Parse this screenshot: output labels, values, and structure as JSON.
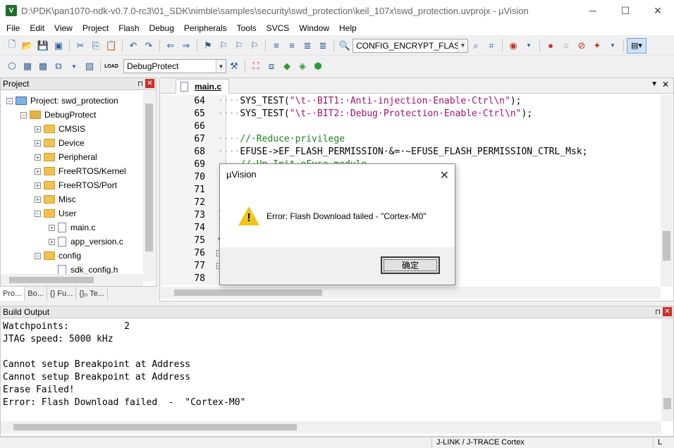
{
  "window": {
    "title": "D:\\PDK\\pan1070-ndk-v0.7.0-rc3\\01_SDK\\nimble\\samples\\security\\swd_protection\\keil_107x\\swd_protection.uvprojx - µVision",
    "icon_label": "V",
    "minimize": "─",
    "maximize": "☐",
    "close": "✕"
  },
  "menu": [
    "File",
    "Edit",
    "View",
    "Project",
    "Flash",
    "Debug",
    "Peripherals",
    "Tools",
    "SVCS",
    "Window",
    "Help"
  ],
  "toolbar": {
    "define_combo": "CONFIG_ENCRYPT_FLASH",
    "target_combo": "DebugProtect",
    "load_label": "LOAD"
  },
  "project_panel": {
    "title": "Project",
    "pin": "⊓",
    "close": "✕",
    "tree": [
      {
        "label": "Project: swd_protection",
        "kind": "project",
        "level": 0,
        "expander": "−"
      },
      {
        "label": "DebugProtect",
        "kind": "target",
        "level": 1,
        "expander": "−"
      },
      {
        "label": "CMSIS",
        "kind": "folder",
        "level": 2,
        "expander": "+"
      },
      {
        "label": "Device",
        "kind": "folder",
        "level": 2,
        "expander": "+"
      },
      {
        "label": "Peripheral",
        "kind": "folder",
        "level": 2,
        "expander": "+"
      },
      {
        "label": "FreeRTOS/Kernel",
        "kind": "folder",
        "level": 2,
        "expander": "+"
      },
      {
        "label": "FreeRTOS/Port",
        "kind": "folder",
        "level": 2,
        "expander": "+"
      },
      {
        "label": "Misc",
        "kind": "folder",
        "level": 2,
        "expander": "+"
      },
      {
        "label": "User",
        "kind": "folder",
        "level": 2,
        "expander": "−"
      },
      {
        "label": "main.c",
        "kind": "file",
        "level": 3,
        "expander": "+"
      },
      {
        "label": "app_version.c",
        "kind": "file",
        "level": 3,
        "expander": "+"
      },
      {
        "label": "config",
        "kind": "folder",
        "level": 2,
        "expander": "−"
      },
      {
        "label": "sdk_config.h",
        "kind": "file",
        "level": 3,
        "expander": ""
      }
    ],
    "tabs": [
      "Pro...",
      "Bo...",
      "{} Fu...",
      "{}₀ Te..."
    ]
  },
  "editor": {
    "tab": "main.c",
    "menu_arrow": "▼",
    "close": "✕",
    "lines": [
      {
        "n": "64",
        "parts": [
          [
            "d",
            "····"
          ],
          [
            "t",
            "SYS_TEST("
          ],
          [
            "s",
            "\"\\t-·BIT1:·Anti-injection·Enable·Ctrl\\n\""
          ],
          [
            "t",
            ");"
          ]
        ]
      },
      {
        "n": "65",
        "parts": [
          [
            "d",
            "····"
          ],
          [
            "t",
            "SYS_TEST("
          ],
          [
            "s",
            "\"\\t-·BIT2:·Debug·Protection·Enable·Ctrl\\n\""
          ],
          [
            "t",
            ");"
          ]
        ]
      },
      {
        "n": "66",
        "parts": []
      },
      {
        "n": "67",
        "parts": [
          [
            "d",
            "····"
          ],
          [
            "c",
            "//·Reduce·privilege"
          ]
        ]
      },
      {
        "n": "68",
        "parts": [
          [
            "d",
            "····"
          ],
          [
            "t",
            "EFUSE->EF_FLASH_PERMISSION·&=·~EFUSE_FLASH_PERMISSION_CTRL_Msk;"
          ]
        ]
      },
      {
        "n": "69",
        "parts": [
          [
            "d",
            "····"
          ],
          [
            "c",
            "//·Un-Init·eFuse·module"
          ]
        ]
      },
      {
        "n": "70",
        "parts": []
      },
      {
        "n": "71",
        "parts": []
      },
      {
        "n": "72",
        "parts": []
      },
      {
        "n": "73",
        "parts": [
          [
            "t",
            "}"
          ]
        ]
      },
      {
        "n": "74",
        "parts": []
      },
      {
        "n": "75",
        "parts": [
          [
            "t",
            "v"
          ]
        ]
      },
      {
        "n": "76",
        "parts": [
          [
            "t",
            "{"
          ]
        ],
        "fold": "−"
      },
      {
        "n": "77",
        "parts": [
          [
            "t",
            "#"
          ]
        ],
        "fold": "−"
      },
      {
        "n": "78",
        "parts": []
      }
    ]
  },
  "build_output": {
    "title": "Build Output",
    "pin": "⊓",
    "close": "✕",
    "lines": [
      "Watchpoints:          2",
      "JTAG speed: 5000 kHz",
      "",
      "Cannot setup Breakpoint at Address",
      "Cannot setup Breakpoint at Address",
      "Erase Failed!",
      "Error: Flash Download failed  -  \"Cortex-M0\""
    ]
  },
  "status": {
    "debugger": "J-LINK / J-TRACE Cortex",
    "line_col": "L"
  },
  "dialog": {
    "title": "µVision",
    "close": "✕",
    "warning_mark": "!",
    "message": "Error: Flash Download failed  -  \"Cortex-M0\"",
    "ok": "确定"
  },
  "colors": {
    "string": "#a0146e",
    "comment": "#208020",
    "warning": "#f0c419"
  }
}
